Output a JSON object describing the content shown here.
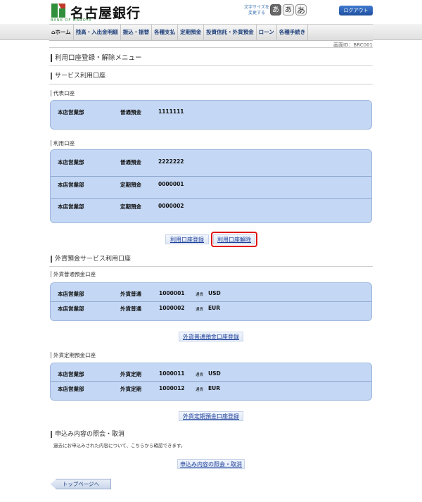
{
  "header": {
    "bank_name": "名古屋銀行",
    "bank_sub": "BANK OF NAGOYA",
    "font_size_label": "文字サイズを変更する",
    "font_buttons": [
      "あ",
      "あ",
      "あ"
    ],
    "logout": "ログアウト"
  },
  "nav": [
    "⌂ホーム",
    "残高・入出金明細",
    "振込・振替",
    "各種支払",
    "定期預金",
    "投資信託・外貨預金",
    "ローン",
    "各種手続き"
  ],
  "screen_id": "画面ID：BRC001",
  "page_title": "利用口座登録・解除メニュー",
  "service_accounts": {
    "heading": "サービス利用口座",
    "rep_heading": "代表口座",
    "rep_rows": [
      {
        "branch": "本店営業部",
        "type": "普通預金",
        "number": "1111111"
      }
    ],
    "use_heading": "利用口座",
    "use_rows": [
      {
        "branch": "本店営業部",
        "type": "普通預金",
        "number": "2222222"
      },
      {
        "branch": "本店営業部",
        "type": "定期預金",
        "number": "0000001"
      },
      {
        "branch": "本店営業部",
        "type": "定期預金",
        "number": "0000002"
      }
    ],
    "register_button": "利用口座登録",
    "release_button": "利用口座解除"
  },
  "fx_accounts": {
    "heading": "外貨預金サービス利用口座",
    "ordinary_heading": "外貨普通預金口座",
    "ordinary_rows": [
      {
        "branch": "本店営業部",
        "type": "外貨普通",
        "number": "1000001",
        "cur_label": "通貨",
        "currency": "USD"
      },
      {
        "branch": "本店営業部",
        "type": "外貨普通",
        "number": "1000002",
        "cur_label": "通貨",
        "currency": "EUR"
      }
    ],
    "ordinary_button": "外貨普通預金口座登録",
    "time_heading": "外貨定期預金口座",
    "time_rows": [
      {
        "branch": "本店営業部",
        "type": "外貨定期",
        "number": "1000011",
        "cur_label": "通貨",
        "currency": "USD"
      },
      {
        "branch": "本店営業部",
        "type": "外貨定期",
        "number": "1000012",
        "cur_label": "通貨",
        "currency": "EUR"
      }
    ],
    "time_button": "外貨定期預金口座登録"
  },
  "inquiry": {
    "heading": "申込み内容の照会・取消",
    "note": "過去にお申込みされた内容について、こちらから確認できます。",
    "button": "申込み内容の照会・取消"
  },
  "top_button": "トップページへ",
  "colors": {
    "accent": "#1d3f9a",
    "box": "#c4d8f5",
    "highlight": "#e01010",
    "brand_green": "#2f8f3a"
  }
}
